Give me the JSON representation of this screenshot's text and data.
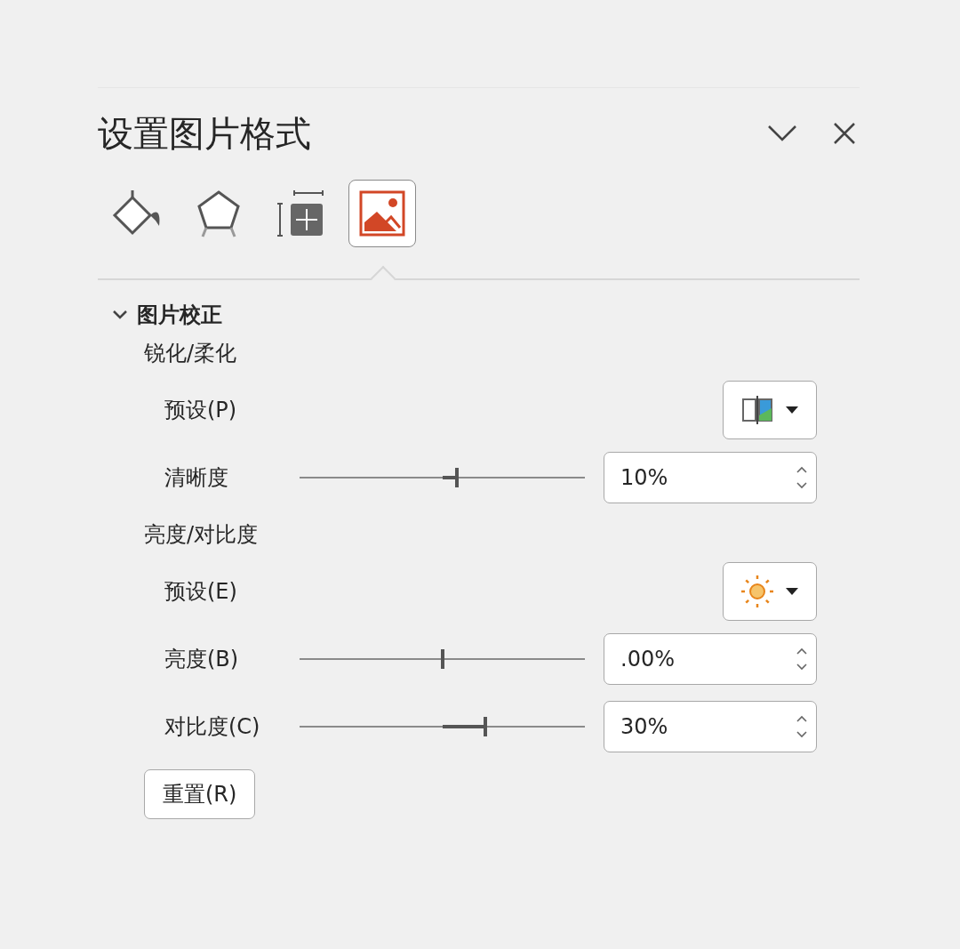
{
  "panel": {
    "title": "设置图片格式"
  },
  "tabs": [
    {
      "kind": "fill",
      "selected": false
    },
    {
      "kind": "effects",
      "selected": false
    },
    {
      "kind": "size",
      "selected": false
    },
    {
      "kind": "picture",
      "selected": true
    }
  ],
  "section": {
    "title": "图片校正",
    "expanded": true,
    "groups": [
      {
        "title": "锐化/柔化",
        "rows": [
          {
            "kind": "preset",
            "label": "预设(P)"
          },
          {
            "kind": "slider",
            "label": "清晰度",
            "level": 0.55,
            "value": "10%"
          }
        ]
      },
      {
        "title": "亮度/对比度",
        "rows": [
          {
            "kind": "preset",
            "label": "预设(E)"
          },
          {
            "kind": "slider",
            "label": "亮度(B)",
            "level": 0.5,
            "value": ".00%"
          },
          {
            "kind": "slider",
            "label": "对比度(C)",
            "level": 0.65,
            "value": "30%"
          }
        ]
      }
    ],
    "reset_button": "重置(R)"
  }
}
